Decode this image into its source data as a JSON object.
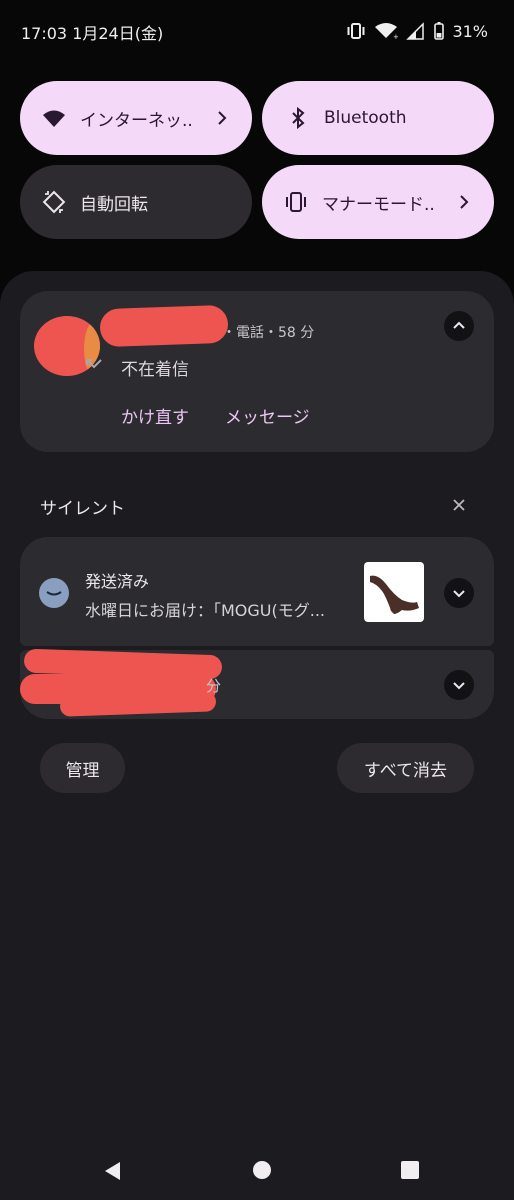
{
  "status_bar": {
    "time_date": "17:03 1月24日(金)",
    "battery": "31%",
    "icons": [
      "vibrate-icon",
      "wifi-icon",
      "signal-icon",
      "battery-icon"
    ]
  },
  "quick_settings": {
    "tiles": [
      {
        "label": "インターネッ..",
        "icon": "wifi-icon",
        "state": "on",
        "has_chevron": true
      },
      {
        "label": "Bluetooth",
        "icon": "bluetooth-icon",
        "state": "on",
        "has_chevron": false
      },
      {
        "label": "自動回転",
        "icon": "rotate-icon",
        "state": "off",
        "has_chevron": false
      },
      {
        "label": "マナーモード..",
        "icon": "vibrate-icon",
        "state": "on",
        "has_chevron": true
      }
    ]
  },
  "call_notification": {
    "meta_suffix": "・電話・58 分",
    "title": "不在着信",
    "actions": [
      "かけ直す",
      "メッセージ"
    ]
  },
  "silent_section": {
    "heading": "サイレント"
  },
  "shipping_notification": {
    "title": "発送済み",
    "body": "水曜日にお届け：「MOGU(モグ..."
  },
  "collapsed_notification": {
    "time_suffix": "分"
  },
  "footer_buttons": {
    "manage": "管理",
    "clear_all": "すべて消去"
  },
  "colors": {
    "tile_on": "#f5d9f8",
    "tile_off": "#2d2b30",
    "card": "#2c2b30",
    "shade": "#1c1b1f",
    "accent_text": "#ecc6f4",
    "redaction": "#f0504d"
  }
}
